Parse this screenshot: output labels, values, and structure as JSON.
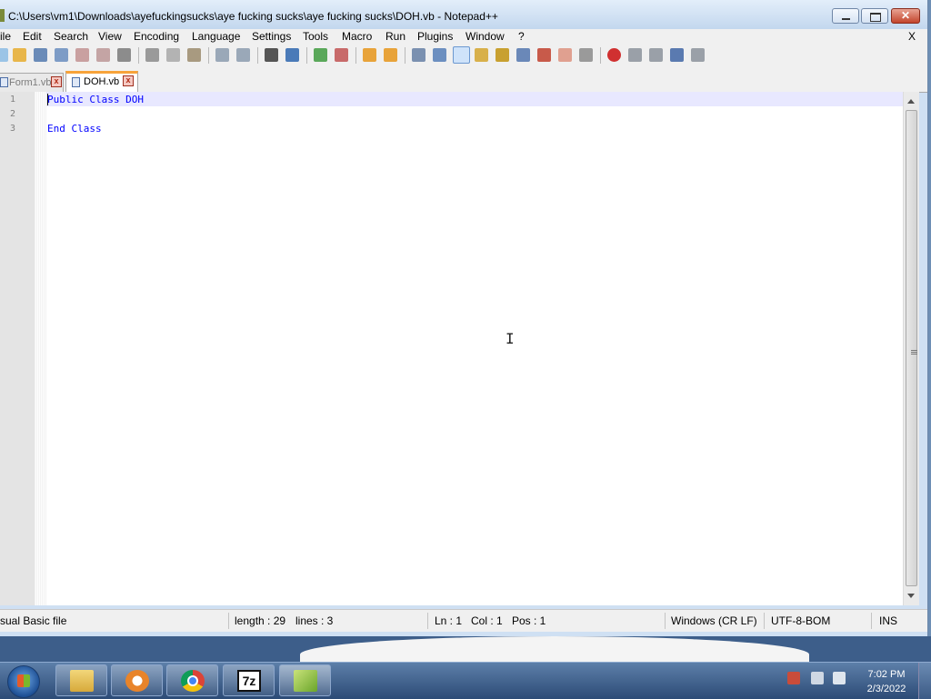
{
  "window": {
    "title": "C:\\Users\\vm1\\Downloads\\ayefuckingsucks\\aye fucking sucks\\aye fucking sucks\\DOH.vb - Notepad++",
    "close_glyph": "✕"
  },
  "menu": {
    "items": [
      "ile",
      "Edit",
      "Search",
      "View",
      "Encoding",
      "Language",
      "Settings",
      "Tools",
      "Macro",
      "Run",
      "Plugins",
      "Window",
      "?"
    ],
    "close": "X"
  },
  "tabs": [
    {
      "label": "Form1.vb",
      "state": "inactive"
    },
    {
      "label": "DOH.vb",
      "state": "active"
    }
  ],
  "tab_close_glyph": "x",
  "editor": {
    "line_numbers": [
      "1",
      "2",
      "3"
    ],
    "lines": [
      "Public Class DOH",
      "",
      "End Class"
    ],
    "current_line": 1,
    "keyword_color": "#0000ff",
    "current_line_color": "#e8e8ff"
  },
  "mouse_cursor": "I",
  "status": {
    "file_type": "sual Basic file",
    "length": "length : 29",
    "lines": "lines : 3",
    "ln": "Ln : 1",
    "col": "Col : 1",
    "pos": "Pos : 1",
    "eol": "Windows (CR LF)",
    "encoding": "UTF-8-BOM",
    "mode": "INS"
  },
  "taskbar": {
    "clock_time": "7:02 PM",
    "clock_date": "2/3/2022",
    "sevenzip_label": "7z",
    "apps": [
      "file-explorer",
      "media-player",
      "chrome",
      "7-zip",
      "notepad-plus-plus"
    ]
  },
  "colors": {
    "titlebar": "#d4e4f7",
    "close_button": "#c84a32",
    "tab_accent": "#f7a33a"
  }
}
